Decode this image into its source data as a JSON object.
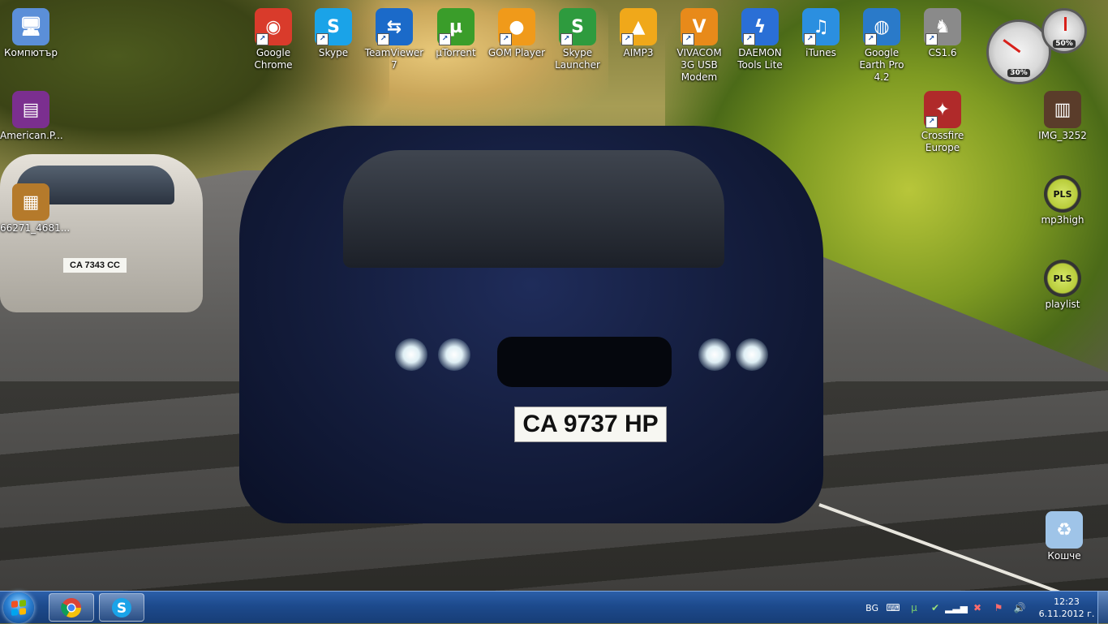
{
  "desktop": {
    "icons": [
      {
        "label": "Компютър",
        "icon": "computer-icon",
        "color": "#5b8fd8",
        "glyph": "🖥",
        "shortcut": false
      },
      {
        "label": "American.P...",
        "icon": "winrar-archive-icon",
        "color": "#7b2f8f",
        "glyph": "▤",
        "shortcut": false
      },
      {
        "label": "66271_4681...",
        "icon": "image-file-icon",
        "color": "#b57a2b",
        "glyph": "▦",
        "shortcut": false
      },
      {
        "label": "Google Chrome",
        "icon": "chrome-icon",
        "color": "#d93b2b",
        "glyph": "◉",
        "shortcut": true
      },
      {
        "label": "Skype",
        "icon": "skype-icon",
        "color": "#1aa3e8",
        "glyph": "S",
        "shortcut": true
      },
      {
        "label": "TeamViewer 7",
        "icon": "teamviewer-icon",
        "color": "#1b6ac9",
        "glyph": "⇆",
        "shortcut": true
      },
      {
        "label": "µTorrent",
        "icon": "utorrent-icon",
        "color": "#3a9d2a",
        "glyph": "µ",
        "shortcut": true
      },
      {
        "label": "GOM Player",
        "icon": "gom-player-icon",
        "color": "#f09a1a",
        "glyph": "●",
        "shortcut": true
      },
      {
        "label": "Skype Launcher",
        "icon": "skype-launcher-icon",
        "color": "#2e9b3e",
        "glyph": "S",
        "shortcut": true
      },
      {
        "label": "AIMP3",
        "icon": "aimp-icon",
        "color": "#f0a81a",
        "glyph": "▲",
        "shortcut": true
      },
      {
        "label": "VIVACOM 3G USB Modem",
        "icon": "vivacom-modem-icon",
        "color": "#e88a1a",
        "glyph": "V",
        "shortcut": true
      },
      {
        "label": "DAEMON Tools Lite",
        "icon": "daemon-tools-icon",
        "color": "#2a6fd6",
        "glyph": "ϟ",
        "shortcut": true
      },
      {
        "label": "iTunes",
        "icon": "itunes-icon",
        "color": "#2b8fe0",
        "glyph": "♫",
        "shortcut": true
      },
      {
        "label": "Google Earth Pro 4.2",
        "icon": "google-earth-icon",
        "color": "#2a7ac9",
        "glyph": "◍",
        "shortcut": true
      },
      {
        "label": "CS1.6",
        "icon": "counter-strike-icon",
        "color": "#8a8a8a",
        "glyph": "♞",
        "shortcut": true
      },
      {
        "label": "Crossfire Europe",
        "icon": "crossfire-icon",
        "color": "#b02a2a",
        "glyph": "✦",
        "shortcut": true
      },
      {
        "label": "IMG_3252",
        "icon": "photo-file-icon",
        "color": "#5a3c2a",
        "glyph": "▥",
        "shortcut": false
      },
      {
        "label": "mp3high",
        "icon": "pls-playlist-icon",
        "color": "#3c3c3c",
        "glyph": "PLS",
        "shortcut": false
      },
      {
        "label": "playlist",
        "icon": "pls-playlist-icon",
        "color": "#3c3c3c",
        "glyph": "PLS",
        "shortcut": false
      },
      {
        "label": "Кошче",
        "icon": "recycle-bin-icon",
        "color": "#9fc4e8",
        "glyph": "♻",
        "shortcut": false
      }
    ]
  },
  "wallpaper": {
    "front_plate": "CA 9737 HP",
    "rear_plate": "CA 7343 CC"
  },
  "gadget": {
    "cpu_percent": 30,
    "memory_percent": 50,
    "cpu_label": "30%",
    "memory_label": "50%"
  },
  "taskbar": {
    "pinned": [
      {
        "icon": "chrome-icon",
        "color": "#d93b2b"
      },
      {
        "icon": "skype-icon",
        "color": "#1aa3e8"
      }
    ],
    "tray": {
      "language": "BG",
      "time": "12:23",
      "date": "6.11.2012 г."
    }
  },
  "colors": {
    "taskbar": "#1d4a8c",
    "label_text": "#ffffff"
  }
}
